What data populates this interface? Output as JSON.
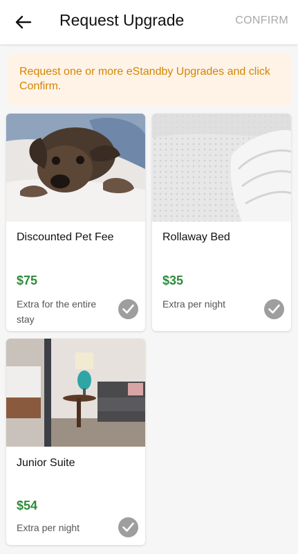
{
  "header": {
    "title": "Request Upgrade",
    "confirm_label": "CONFIRM"
  },
  "banner": {
    "text": "Request one or more eStandby Upgrades and click Confirm."
  },
  "upgrades": [
    {
      "name": "Discounted Pet Fee",
      "price": "$75",
      "unit": "Extra for the entire stay"
    },
    {
      "name": "Rollaway Bed",
      "price": "$35",
      "unit": "Extra per night"
    },
    {
      "name": "Junior Suite",
      "price": "$54",
      "unit": "Extra per night"
    }
  ],
  "colors": {
    "accent_text": "#d38500",
    "banner_bg": "#fff3e8",
    "price": "#2e8b3a",
    "check": "#9e9e9e"
  }
}
